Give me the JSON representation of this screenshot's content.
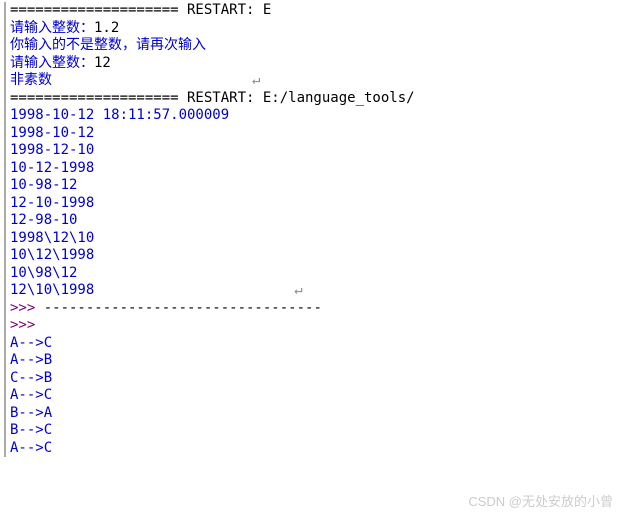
{
  "section1": {
    "restart": "==================== RESTART: E",
    "lines": [
      {
        "prompt": "请输入整数：",
        "input": "1.2"
      },
      {
        "text": "你输入的不是整数，请再次输入"
      },
      {
        "prompt": "请输入整数：",
        "input": "12"
      },
      {
        "text": "非素数"
      }
    ],
    "cursor": "↵"
  },
  "section2": {
    "restart": "==================== RESTART: E:/language_tools/",
    "lines": [
      "1998-10-12 18:11:57.000009",
      "1998-10-12",
      "1998-12-10",
      "10-12-1998",
      "10-98-12",
      "12-10-1998",
      "12-98-10",
      "1998\\12\\10",
      "10\\12\\1998",
      "10\\98\\12",
      "12\\10\\1998"
    ],
    "cursor": "↵"
  },
  "section3": {
    "prompt1": ">>> ",
    "dashes": "---------------------------------",
    "prompt2": ">>> ",
    "lines": [
      "A-->C",
      "A-->B",
      "C-->B",
      "A-->C",
      "B-->A",
      "B-->C",
      "A-->C"
    ]
  },
  "watermark": "CSDN @无处安放的小曾"
}
